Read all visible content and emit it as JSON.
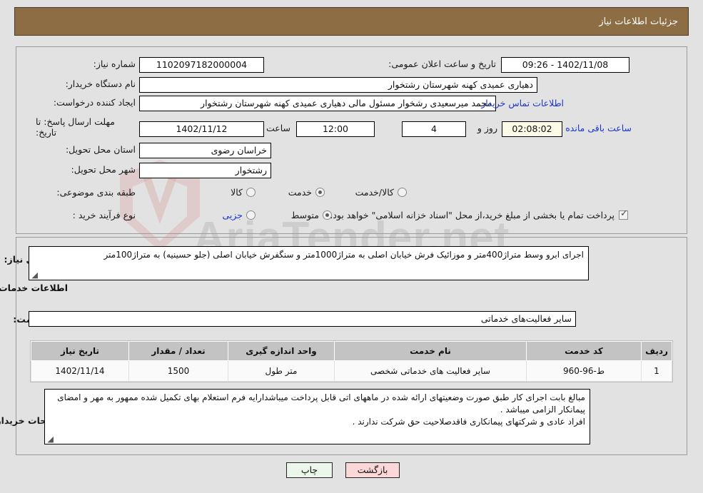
{
  "header": {
    "title": "جزئیات اطلاعات نیاز"
  },
  "form": {
    "need_number": {
      "label": "شماره نیاز:",
      "value": "1102097182000004"
    },
    "announce_datetime": {
      "label": "تاریخ و ساعت اعلان عمومی:",
      "value": "1402/11/08 - 09:26"
    },
    "buyer_org": {
      "label": "نام دستگاه خریدار:",
      "value": "دهیاری عمیدی کهنه شهرستان رشتخوار"
    },
    "requester": {
      "label": "ایجاد کننده درخواست:",
      "value": "محمد میرسعیدی رشخوار مسئول مالی دهیاری عمیدی کهنه شهرستان رشتخوار"
    },
    "contact_link": "اطلاعات تماس خریدار",
    "deadline": {
      "label": "مهلت ارسال پاسخ: تا تاریخ:",
      "date": "1402/11/12",
      "time_label": "ساعت",
      "time": "12:00",
      "days_value": "4",
      "days_label": "روز و",
      "countdown": "02:08:02",
      "remaining_label": "ساعت باقی مانده"
    },
    "province": {
      "label": "استان محل تحویل:",
      "value": "خراسان رضوی"
    },
    "city": {
      "label": "شهر محل تحویل:",
      "value": "رشتخوار"
    },
    "category": {
      "label": "طبقه بندی موضوعی:",
      "options": [
        "کالا",
        "خدمت",
        "کالا/خدمت"
      ],
      "selected_index": 1
    },
    "purchase_type": {
      "label": "نوع فرآیند خرید :",
      "options": [
        "جزیی",
        "متوسط"
      ],
      "selected_index": 1,
      "treasury_checkbox": {
        "checked": true,
        "text": "پرداخت تمام یا بخشی از مبلغ خرید،از محل \"اسناد خزانه اسلامی\" خواهد بود."
      }
    }
  },
  "need_summary": {
    "label": "شرح کلی نیاز:",
    "value": "اجرای ابرو وسط  متراژ400متر و موزائیک فرش خیابان اصلی به متراژ1000متر و سنگفرش خیابان اصلی (جلو حسینیه) به متراژ100متر"
  },
  "services_section": {
    "heading": "اطلاعات خدمات مورد نیاز",
    "group_label": "گروه خدمت:",
    "group_value": "سایر فعالیت‌های خدماتی"
  },
  "table": {
    "columns": [
      "ردیف",
      "کد خدمت",
      "نام خدمت",
      "واحد اندازه گیری",
      "تعداد / مقدار",
      "تاریخ نیاز"
    ],
    "rows": [
      {
        "row_no": "1",
        "service_code": "ط-96-960",
        "service_name": "سایر فعالیت های خدماتی شخصی",
        "unit": "متر طول",
        "quantity": "1500",
        "need_date": "1402/11/14"
      }
    ]
  },
  "buyer_notes": {
    "label": "توضیحات خریدار:",
    "lines": [
      "مبالغ بابت اجرای کار طبق صورت وضعیتهای ارائه شده در ماههای اتی قابل پرداخت میباشدارایه فرم استعلام بهای تکمیل شده ممهور به مهر و امضای پیمانکار الزامی میباشد .",
      "افراد عادی و شرکتهای پیمانکاری فاقدصلاحیت حق شرکت ندارند ."
    ]
  },
  "footer": {
    "print_label": "چاپ",
    "back_label": "بازگشت"
  },
  "watermark": {
    "text": "AriaTender.net"
  },
  "colors": {
    "header_bg": "#8d6d44",
    "link": "#1d35c8",
    "countdown_bg": "#fbfbe8",
    "table_header_bg": "#c3c3c3",
    "print_btn_bg": "#eaf7ea",
    "back_btn_bg": "#fbd7d7"
  }
}
